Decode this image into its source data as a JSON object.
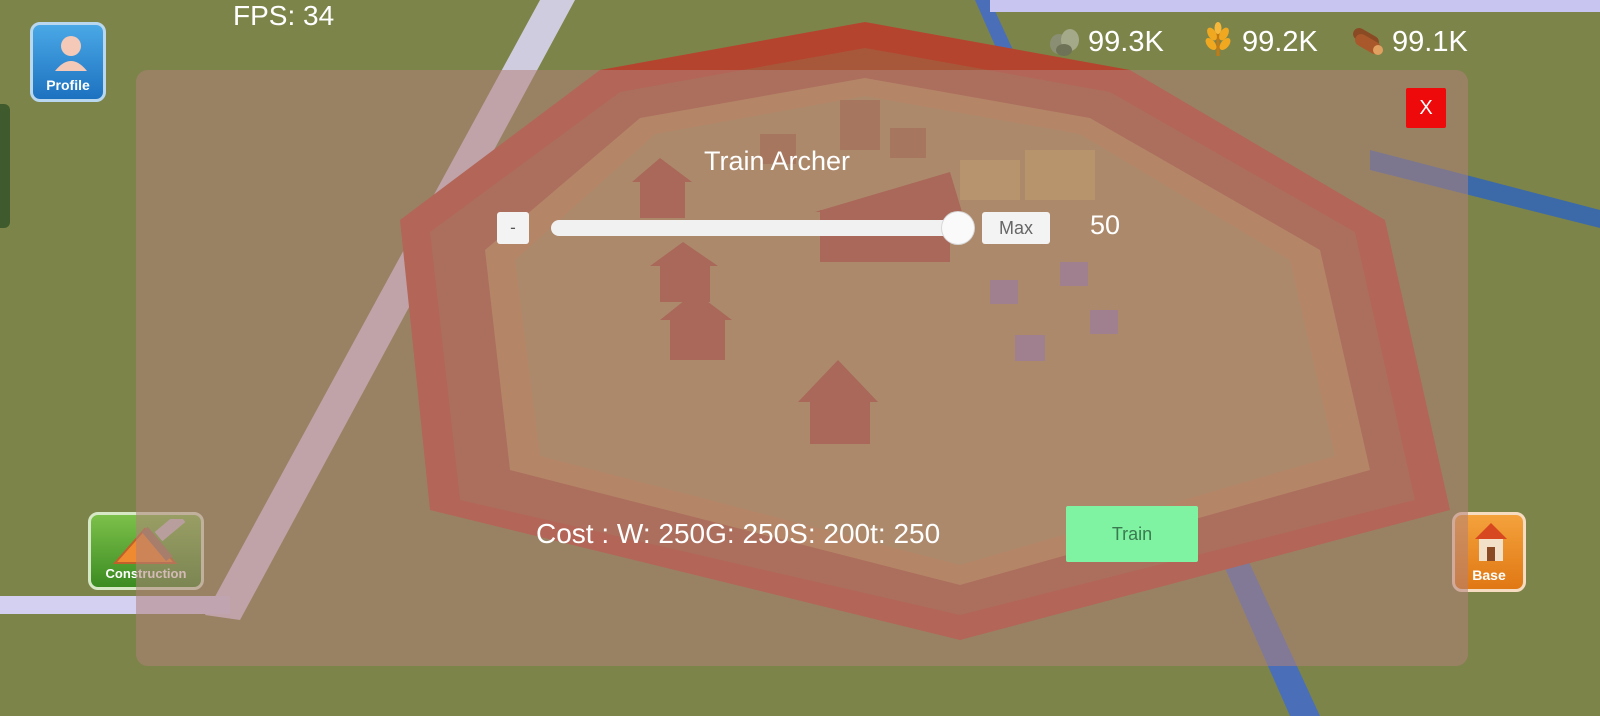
{
  "hud": {
    "fps": "FPS: 34",
    "resources": [
      {
        "icon": "stone-icon",
        "value": "99.3K"
      },
      {
        "icon": "wheat-icon",
        "value": "99.2K"
      },
      {
        "icon": "wood-logs-icon",
        "value": "99.1K"
      }
    ]
  },
  "buttons": {
    "profile": "Profile",
    "construction": "Construction",
    "base": "Base"
  },
  "dialog": {
    "title": "Train Archer",
    "close": "X",
    "minus": "-",
    "max": "Max",
    "quantity": "50",
    "slider_fraction": 1.0,
    "cost": "Cost : W: 250G: 250S: 200t: 250",
    "train": "Train"
  },
  "colors": {
    "close": "#ee0a0a",
    "train": "#80f3a2",
    "panel_overlay": "rgba(176,130,122,0.55)"
  }
}
